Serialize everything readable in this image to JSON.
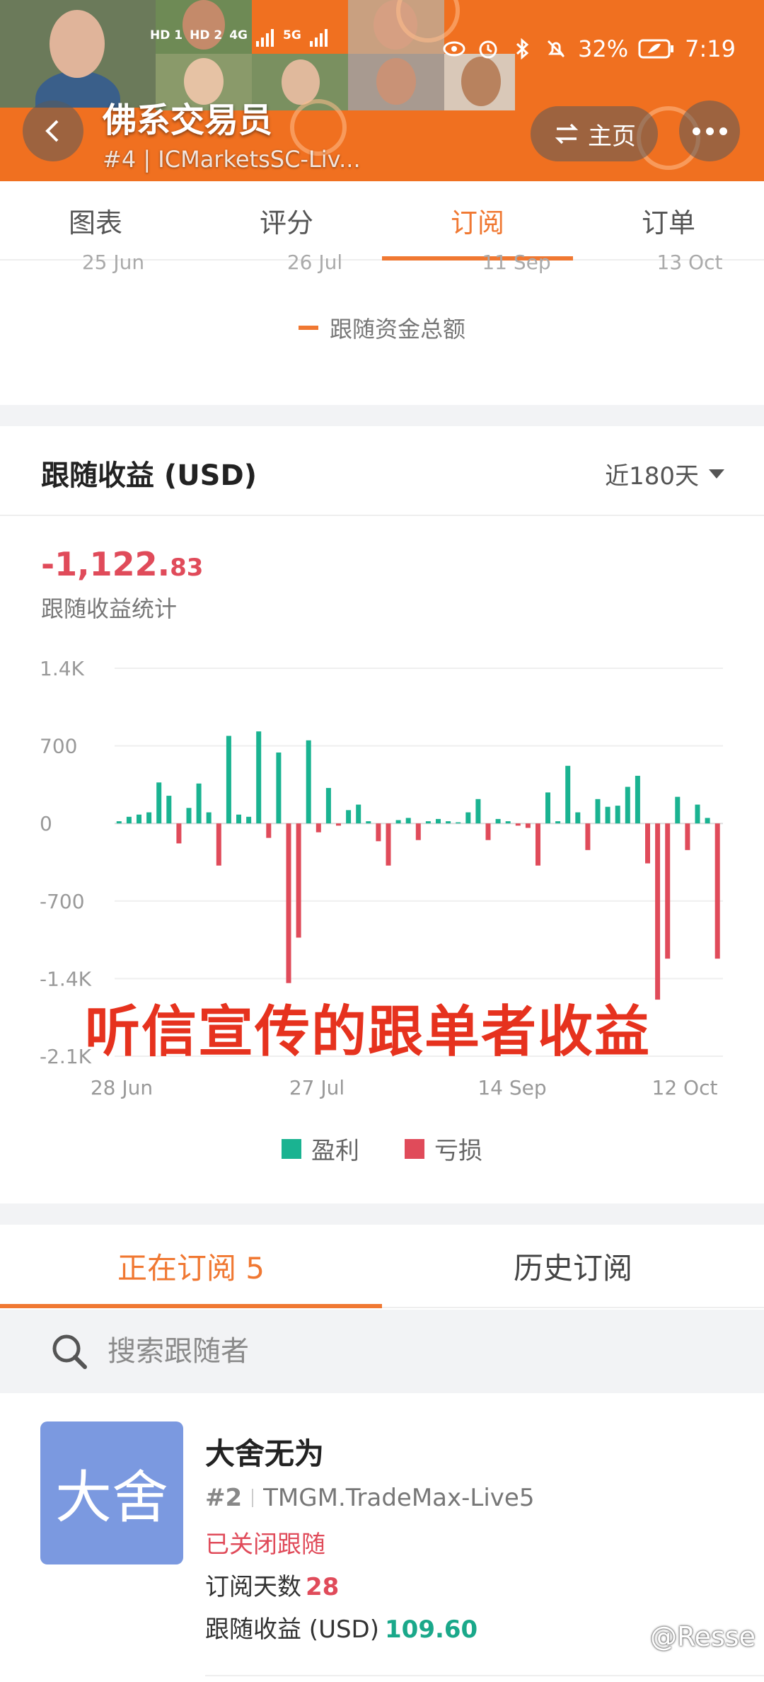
{
  "colors": {
    "accent": "#f07832",
    "profit": "#1ab391",
    "loss": "#e04b5a",
    "gray_band": "#f2f3f5"
  },
  "status_bar": {
    "network": [
      "HD 1",
      "HD 2",
      "4G",
      "5G"
    ],
    "battery": "32%",
    "time": "7:19"
  },
  "header": {
    "title": "佛系交易员",
    "subtitle": "#4 | ICMarketsSC-Liv...",
    "home_label": "主页",
    "back_icon": "chevron-left-icon",
    "more_icon": "more-dots-icon"
  },
  "tabs": [
    {
      "label": "图表",
      "active": false
    },
    {
      "label": "评分",
      "active": false
    },
    {
      "label": "订阅",
      "active": true
    },
    {
      "label": "订单",
      "active": false
    }
  ],
  "top_chart": {
    "x_ticks": [
      "25 Jun",
      "26 Jul",
      "11 Sep",
      "13 Oct"
    ],
    "legend": "跟随资金总额"
  },
  "income": {
    "title": "跟随收益 (USD)",
    "period": "近180天",
    "total_int": "-1,122.",
    "total_dec": "83",
    "total_label": "跟随收益统计"
  },
  "chart_data": {
    "type": "bar",
    "title": "",
    "y_ticks": [
      "1.4K",
      "700",
      "0",
      "-700",
      "-1.4K",
      "-2.1K"
    ],
    "ylim": [
      -2100,
      1400
    ],
    "x_ticks": [
      "28 Jun",
      "27 Jul",
      "14 Sep",
      "12 Oct"
    ],
    "legend": [
      {
        "name": "盈利",
        "color": "#1ab391"
      },
      {
        "name": "亏损",
        "color": "#e04b5a"
      }
    ],
    "values": [
      20,
      60,
      80,
      100,
      370,
      250,
      -180,
      140,
      360,
      100,
      -380,
      790,
      80,
      60,
      830,
      -130,
      640,
      -1440,
      -1030,
      750,
      -80,
      320,
      -20,
      120,
      170,
      20,
      -160,
      -380,
      30,
      50,
      -150,
      20,
      40,
      20,
      10,
      100,
      220,
      -150,
      40,
      20,
      -20,
      -40,
      -380,
      280,
      20,
      520,
      100,
      -240,
      220,
      150,
      160,
      330,
      430,
      -360,
      -1590,
      -1220,
      240,
      -240,
      170,
      50,
      -1220
    ]
  },
  "caption": "听信宣传的跟单者收益",
  "subscriptions": {
    "tabs": [
      {
        "label": "正在订阅 5",
        "active": true
      },
      {
        "label": "历史订阅",
        "active": false
      }
    ],
    "search_placeholder": "搜索跟随者"
  },
  "follower": {
    "avatar_text": "大舍",
    "name": "大舍无为",
    "rank": "#2",
    "server": "TMGM.TradeMax-Live5",
    "status": "已关闭跟随",
    "days_label": "订阅天数",
    "days": "28",
    "income_label": "跟随收益 (USD)",
    "income": "109.60"
  },
  "watermark": "@Resse"
}
